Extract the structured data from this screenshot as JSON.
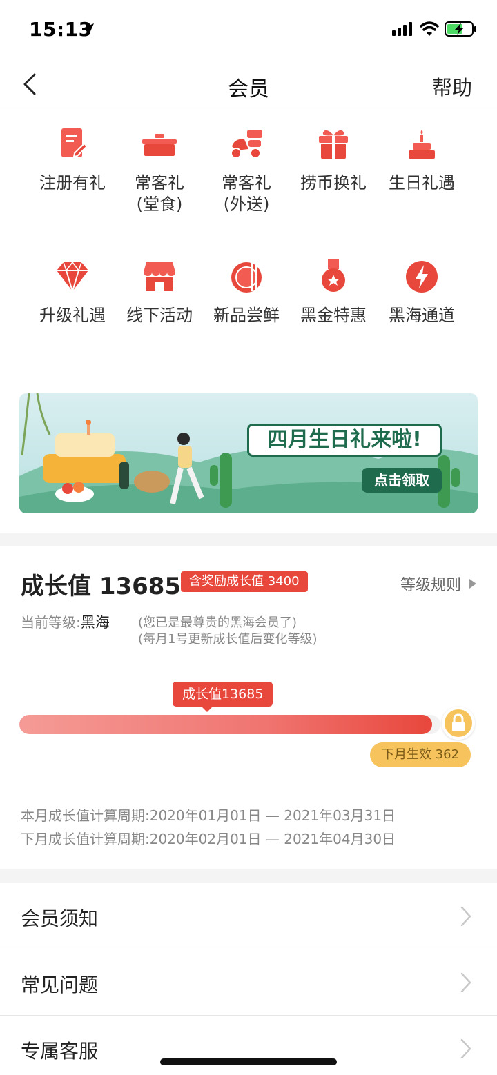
{
  "status_bar": {
    "time": "15:13"
  },
  "nav": {
    "title": "会员",
    "help": "帮助"
  },
  "benefits_row1": [
    {
      "line1": "注册有礼",
      "line2": "",
      "icon": "register-gift-icon"
    },
    {
      "line1": "常客礼",
      "line2": "(堂食)",
      "icon": "dine-in-pot-icon"
    },
    {
      "line1": "常客礼",
      "line2": "(外送)",
      "icon": "delivery-scooter-icon"
    },
    {
      "line1": "捞币换礼",
      "line2": "",
      "icon": "gift-box-icon"
    },
    {
      "line1": "生日礼遇",
      "line2": "",
      "icon": "birthday-cake-icon"
    }
  ],
  "benefits_row2": [
    {
      "line1": "升级礼遇",
      "icon": "diamond-icon"
    },
    {
      "line1": "线下活动",
      "icon": "store-icon"
    },
    {
      "line1": "新品尝鲜",
      "icon": "new-dish-icon"
    },
    {
      "line1": "黑金特惠",
      "icon": "medal-icon"
    },
    {
      "line1": "黑海通道",
      "icon": "lightning-icon"
    }
  ],
  "banner": {
    "title": "四月生日礼来啦!",
    "cta": "点击领取"
  },
  "growth": {
    "title": "成长值 13685",
    "badge": "含奖励成长值 3400",
    "rules": "等级规则",
    "level_label": "当前等级:",
    "level_value": "黑海",
    "note1": "(您已是最尊贵的黑海会员了)",
    "note2": "(每月1号更新成长值后变化等级)",
    "bubble": "成长值13685",
    "progress_fraction": 0.98,
    "next_tag": "下月生效 362",
    "period_current": "本月成长值计算周期:2020年01月01日 — 2021年03月31日",
    "period_next": "下月成长值计算周期:2020年02月01日 — 2021年04月30日"
  },
  "list": [
    {
      "label": "会员须知"
    },
    {
      "label": "常见问题"
    },
    {
      "label": "专属客服"
    }
  ],
  "colors": {
    "accent": "#e8473c",
    "gold": "#f6c35c",
    "banner_green": "#1f6b4e"
  }
}
